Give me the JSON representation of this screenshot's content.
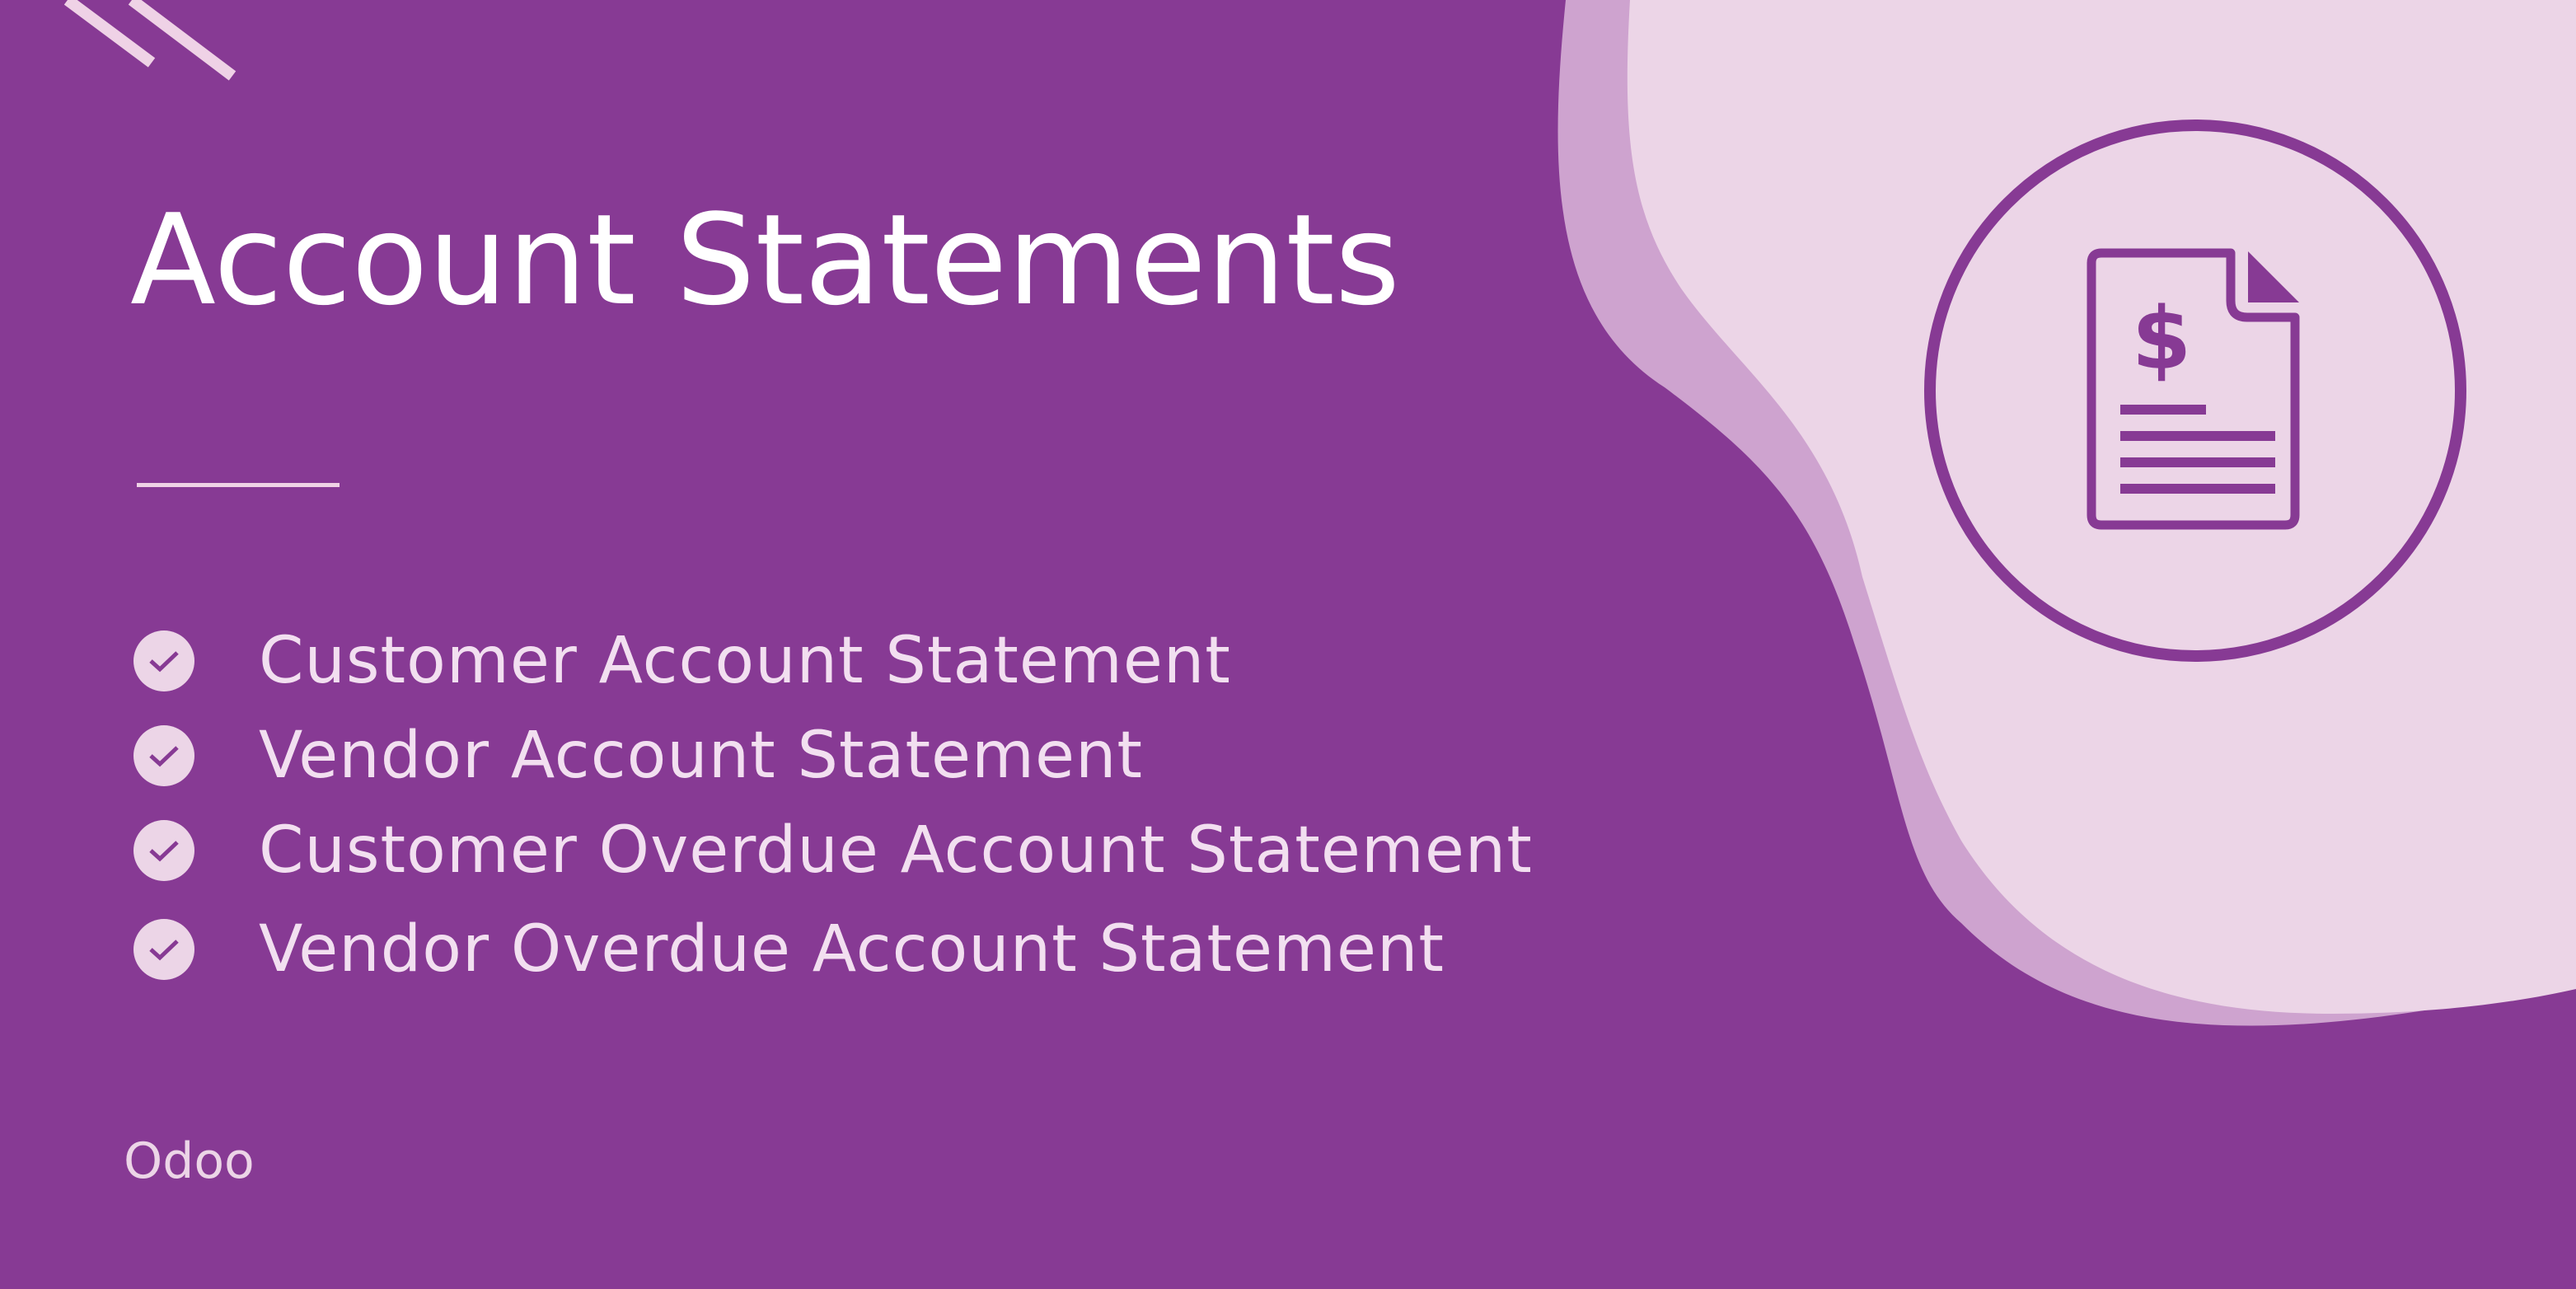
{
  "title": "Account Statements",
  "features": [
    "Customer Account Statement",
    "Vendor Account Statement",
    "Customer Overdue Account Statement",
    "Vendor Overdue Account Statement"
  ],
  "brand": "Odoo",
  "icons": {
    "feature_bullet": "check-icon",
    "hero": "invoice-document-icon",
    "currency_symbol": "$"
  },
  "colors": {
    "background": "#873a94",
    "blob_outer": "#cea3cf",
    "blob_inner": "#ecd5e7",
    "text": "#ffffff",
    "accent": "#873a94"
  }
}
